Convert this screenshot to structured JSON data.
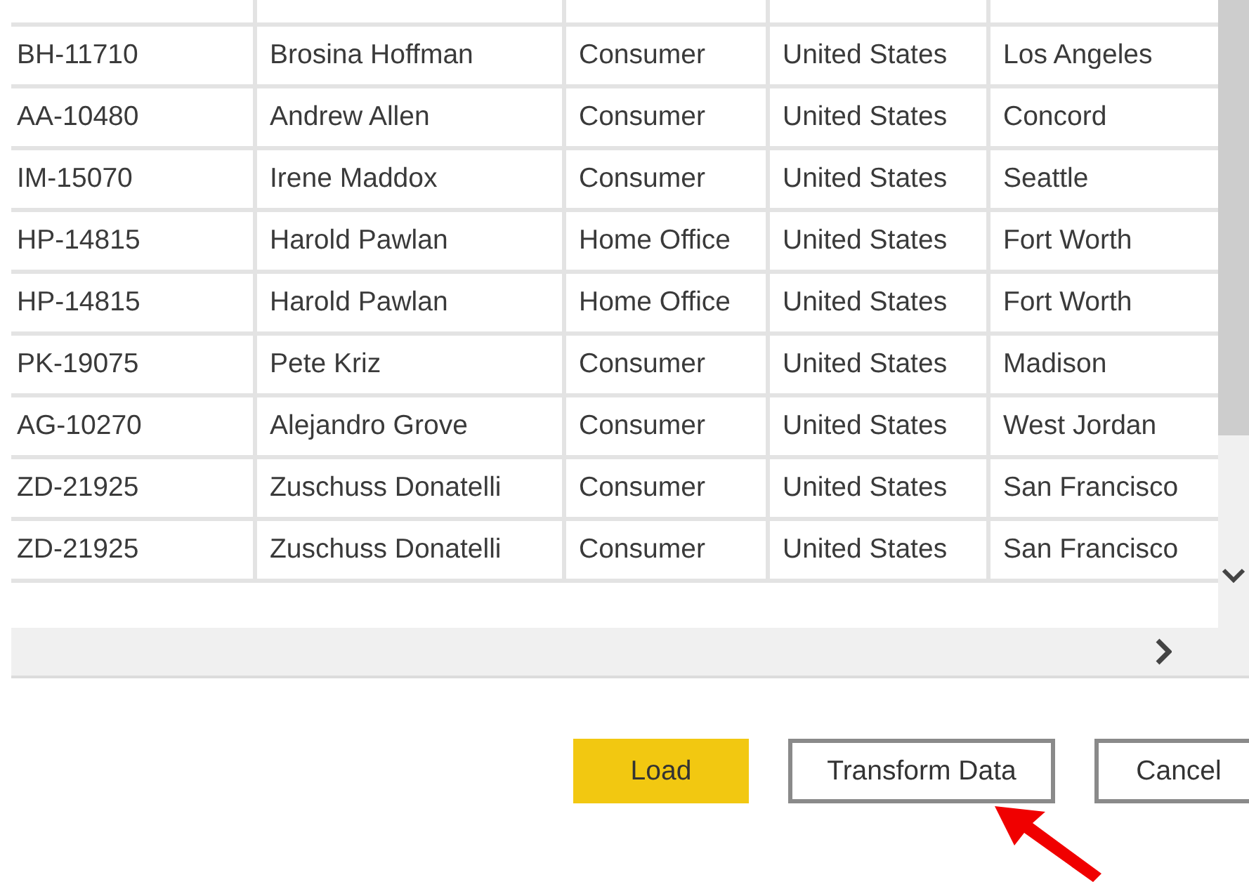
{
  "table": {
    "rows": [
      {
        "cells": [
          "BH-11710",
          "Brosina Hoffman",
          "Consumer",
          "United States",
          "Los Angeles"
        ]
      },
      {
        "cells": [
          "AA-10480",
          "Andrew Allen",
          "Consumer",
          "United States",
          "Concord"
        ]
      },
      {
        "cells": [
          "IM-15070",
          "Irene Maddox",
          "Consumer",
          "United States",
          "Seattle"
        ]
      },
      {
        "cells": [
          "HP-14815",
          "Harold Pawlan",
          "Home Office",
          "United States",
          "Fort Worth"
        ]
      },
      {
        "cells": [
          "HP-14815",
          "Harold Pawlan",
          "Home Office",
          "United States",
          "Fort Worth"
        ]
      },
      {
        "cells": [
          "PK-19075",
          "Pete Kriz",
          "Consumer",
          "United States",
          "Madison"
        ]
      },
      {
        "cells": [
          "AG-10270",
          "Alejandro Grove",
          "Consumer",
          "United States",
          "West Jordan"
        ]
      },
      {
        "cells": [
          "ZD-21925",
          "Zuschuss Donatelli",
          "Consumer",
          "United States",
          "San Francisco"
        ]
      },
      {
        "cells": [
          "ZD-21925",
          "Zuschuss Donatelli",
          "Consumer",
          "United States",
          "San Francisco"
        ]
      }
    ]
  },
  "buttons": [
    {
      "label": "Load",
      "kind": "primary"
    },
    {
      "label": "Transform Data",
      "kind": "secondary"
    },
    {
      "label": "Cancel",
      "kind": "secondary"
    }
  ]
}
